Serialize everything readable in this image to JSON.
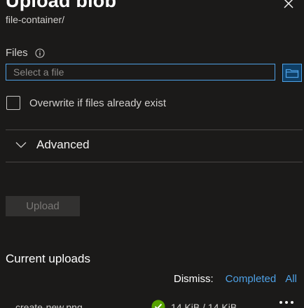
{
  "panel": {
    "title": "Upload blob",
    "subtitle": "file-container/"
  },
  "form": {
    "files_label": "Files",
    "file_placeholder": "Select a file",
    "overwrite_label": "Overwrite if files already exist",
    "overwrite_checked": false,
    "advanced_label": "Advanced",
    "upload_label": "Upload"
  },
  "uploads": {
    "heading": "Current uploads",
    "dismiss_label": "Dismiss:",
    "dismiss_completed": "Completed",
    "dismiss_all": "All",
    "items": [
      {
        "name": "create-new.png",
        "size": "14 KiB / 14 KiB",
        "status_icon": "check-circle-icon"
      }
    ]
  },
  "colors": {
    "background": "#1b1a19",
    "accent": "#4ea1e6",
    "success": "#57a300",
    "divider": "#484644"
  }
}
